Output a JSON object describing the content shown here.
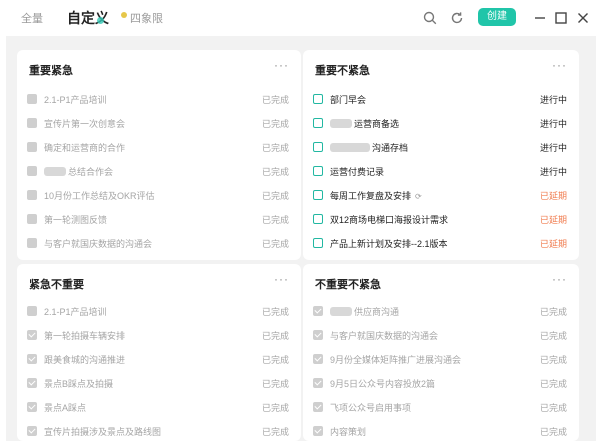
{
  "tabs": [
    {
      "label": "全量",
      "active": false
    },
    {
      "label": "自定义",
      "active": true
    },
    {
      "label": "四象限",
      "active": false
    }
  ],
  "toolbar": {
    "icons": [
      "search-icon",
      "refresh-icon"
    ],
    "create_label": "创建",
    "window_icons": [
      "minimize-icon",
      "maximize-icon",
      "close-icon"
    ],
    "accent_color": "#20c5a9"
  },
  "quadrants": {
    "q1": {
      "title": "重要紧急",
      "more": "···",
      "items": [
        {
          "text": "2.1-P1产品培训",
          "status": "已完成"
        },
        {
          "text": "宣传片第一次创意会",
          "status": "已完成"
        },
        {
          "text": "确定和运营商的合作",
          "status": "已完成"
        },
        {
          "text": "总结合作会",
          "status": "已完成"
        },
        {
          "text": "10月份工作总结及OKR评估",
          "status": "已完成"
        },
        {
          "text": "第一轮测图反馈",
          "status": "已完成"
        },
        {
          "text": "与客户就国庆数据的沟通会",
          "status": "已完成"
        }
      ]
    },
    "q2": {
      "title": "重要不紧急",
      "more": "···",
      "items": [
        {
          "text": "部门早会",
          "status": "进行中"
        },
        {
          "text": "运营商备选",
          "status": "进行中"
        },
        {
          "text": "沟通存档",
          "status": "进行中"
        },
        {
          "text": "运营付费记录",
          "status": "进行中"
        },
        {
          "text": "每周工作复盘及安排",
          "status": "已延期"
        },
        {
          "text": "双12商场电梯口海报设计需求",
          "status": "已延期"
        },
        {
          "text": "产品上新计划及安排--2.1版本",
          "status": "已延期"
        }
      ]
    },
    "q3": {
      "title": "紧急不重要",
      "more": "···",
      "items": [
        {
          "text": "2.1-P1产品培训",
          "status": "已完成"
        },
        {
          "text": "第一轮拍摄车辆安排",
          "status": "已完成"
        },
        {
          "text": "跟美食城的沟通推进",
          "status": "已完成"
        },
        {
          "text": "景点B踩点及拍摄",
          "status": "已完成"
        },
        {
          "text": "景点A踩点",
          "status": "已完成"
        },
        {
          "text": "宣传片拍摄涉及景点及路线图",
          "status": "已完成"
        }
      ]
    },
    "q4": {
      "title": "不重要不紧急",
      "more": "···",
      "items": [
        {
          "text": "供应商沟通",
          "status": "已完成"
        },
        {
          "text": "与客户就国庆数据的沟通会",
          "status": "已完成"
        },
        {
          "text": "9月份全媒体矩阵推广进展沟通会",
          "status": "已完成"
        },
        {
          "text": "9月5日公众号内容投放2篇",
          "status": "已完成"
        },
        {
          "text": "飞项公众号启用事项",
          "status": "已完成"
        },
        {
          "text": "内容策划",
          "status": "已完成"
        }
      ]
    }
  }
}
